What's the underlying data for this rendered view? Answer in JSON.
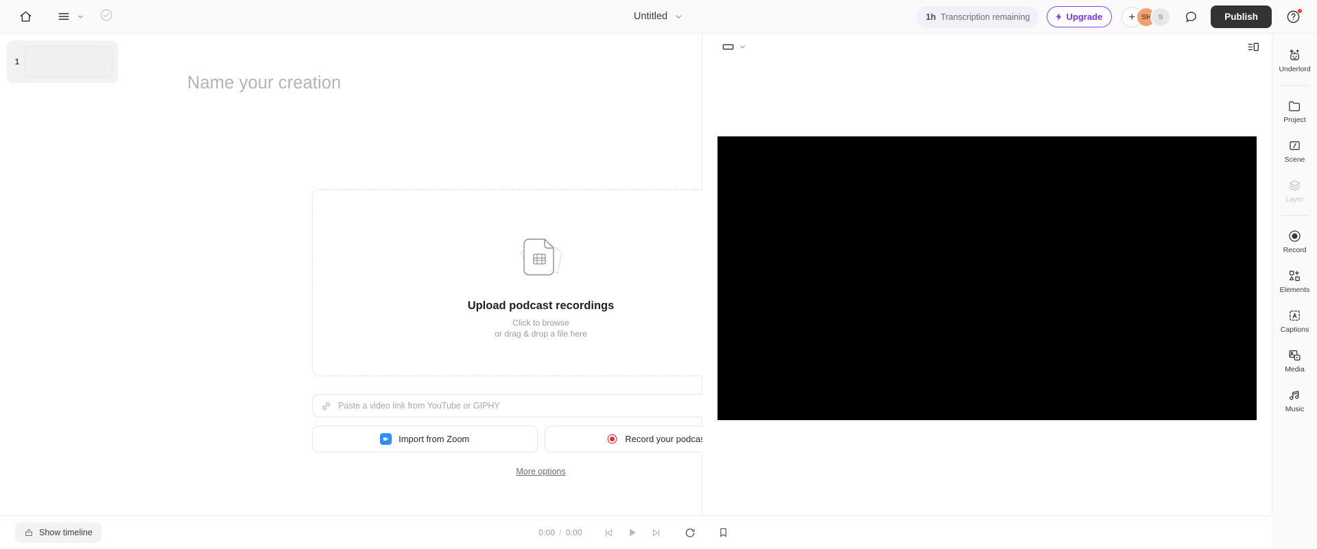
{
  "topbar": {
    "home_icon": "home-icon",
    "menu_icon": "hamburger-menu-icon",
    "menu_chevron_icon": "chevron-down-icon",
    "status_icon": "check-circle-icon",
    "doc_title": "Untitled",
    "title_chevron_icon": "chevron-down-icon",
    "transcription": {
      "hours": "1h",
      "label": "Transcription remaining"
    },
    "upgrade": {
      "label": "Upgrade",
      "icon": "lightning-bolt-icon",
      "color": "#7b2ff7"
    },
    "avatars": {
      "add_label": "+",
      "members": [
        {
          "initials": "SH",
          "color": "#f0a170"
        },
        {
          "initials": "S",
          "color": "#e8e8e8"
        }
      ]
    },
    "comment_icon": "comment-bubble-icon",
    "publish_label": "Publish",
    "help_icon": "help-circle-icon",
    "help_badge_color": "#f03b3b"
  },
  "scene_rail": {
    "scenes": [
      {
        "number": "1"
      }
    ]
  },
  "editor": {
    "title_placeholder": "Name your creation",
    "title_value": "",
    "upload": {
      "icon": "file-video-stack-icon",
      "title": "Upload podcast recordings",
      "sub_line1": "Click to browse",
      "sub_line2": "or drag & drop a file here"
    },
    "link": {
      "icon": "link-chain-icon",
      "placeholder": "Paste a video link from YouTube or GIPHY",
      "value": "",
      "submit_icon": "arrow-up-circle-icon"
    },
    "actions": [
      {
        "label": "Import from Zoom",
        "icon": "zoom-app-icon"
      },
      {
        "label": "Record your podcast",
        "icon": "record-circle-icon"
      }
    ],
    "more_options_label": "More options"
  },
  "preview": {
    "ratio_icon": "aspect-ratio-icon",
    "ratio_chevron_icon": "chevron-down-icon",
    "panel_toggle_icon": "panel-layout-icon"
  },
  "tool_rail": [
    {
      "label": "Underlord",
      "icon": "robot-sparkle-icon",
      "disabled": false
    },
    {
      "label": "Project",
      "icon": "folder-icon",
      "disabled": false
    },
    {
      "label": "Scene",
      "icon": "scene-slash-icon",
      "disabled": false
    },
    {
      "label": "Layer",
      "icon": "layers-icon",
      "disabled": true
    },
    {
      "label": "Record",
      "icon": "record-circle-icon",
      "disabled": false
    },
    {
      "label": "Elements",
      "icon": "shapes-plus-icon",
      "disabled": false
    },
    {
      "label": "Captions",
      "icon": "captions-a-icon",
      "disabled": false
    },
    {
      "label": "Media",
      "icon": "media-image-play-icon",
      "disabled": false
    },
    {
      "label": "Music",
      "icon": "music-notes-icon",
      "disabled": false
    }
  ],
  "bottombar": {
    "show_timeline_label": "Show timeline",
    "show_timeline_icon": "chevron-up-box-icon",
    "current_time": "0:00",
    "separator": "/",
    "total_time": "0:00",
    "skip_back_icon": "skip-back-icon",
    "play_icon": "play-icon",
    "skip_forward_icon": "skip-forward-icon",
    "loop_icon": "loop-refresh-icon",
    "bookmark_icon": "bookmark-icon"
  }
}
